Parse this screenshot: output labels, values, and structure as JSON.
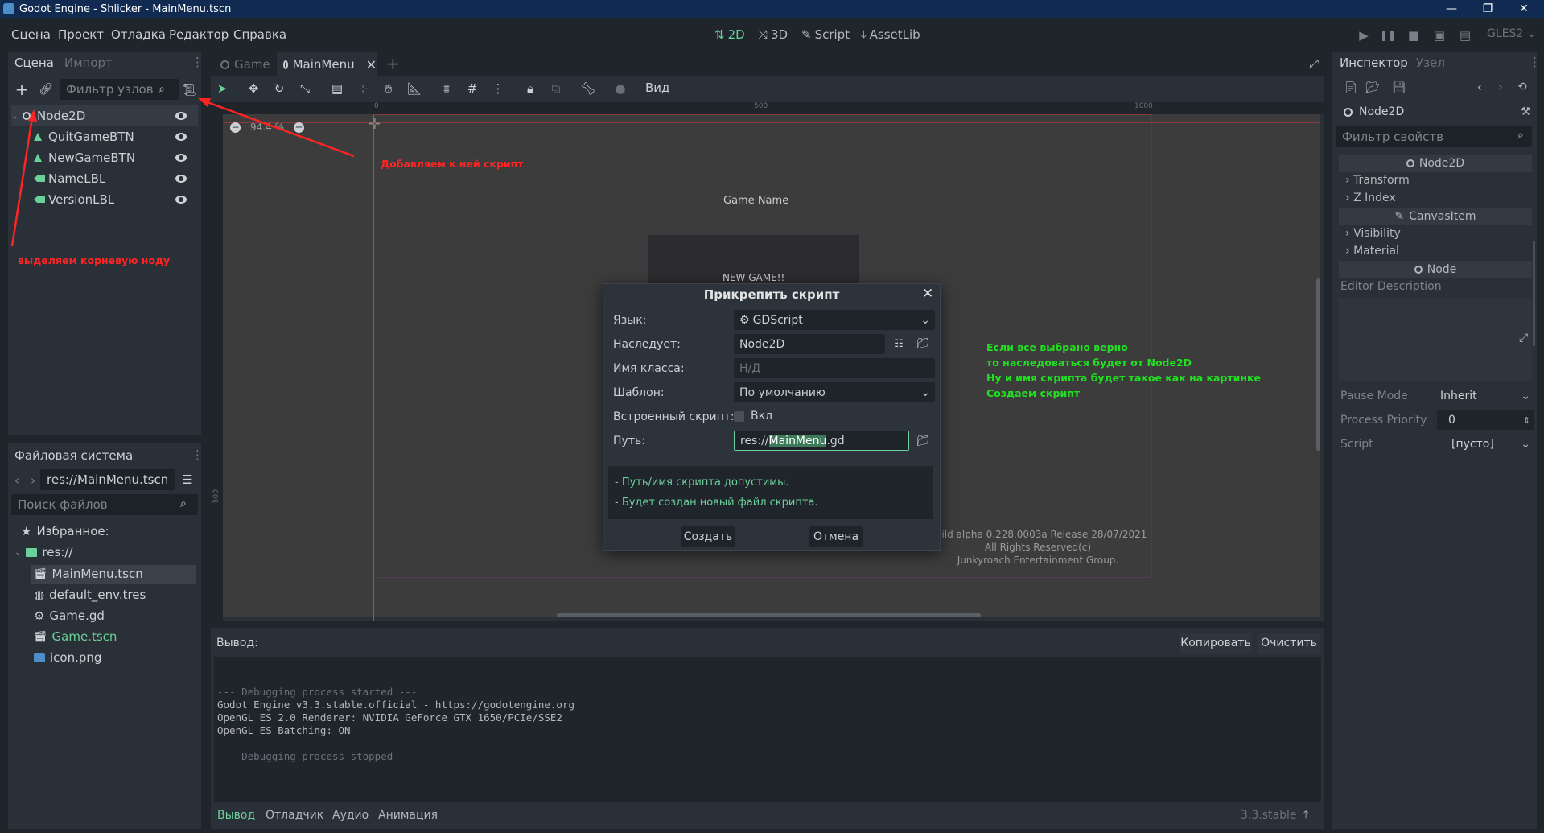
{
  "window": {
    "title": "Godot Engine - Shlicker - MainMenu.tscn",
    "controls": [
      "—",
      "❐",
      "✕"
    ]
  },
  "menubar": {
    "items": [
      "Сцена",
      "Проект",
      "Отладка",
      "Редактор",
      "Справка"
    ],
    "modes": [
      "2D",
      "3D",
      "Script",
      "AssetLib"
    ],
    "renderer": "GLES2"
  },
  "scene_dock": {
    "tabs": [
      "Сцена",
      "Импорт"
    ],
    "filter_placeholder": "Фильтр узлов",
    "nodes": [
      {
        "name": "Node2D",
        "icon": "node2d-icon"
      },
      {
        "name": "QuitGameBTN",
        "icon": "button-icon"
      },
      {
        "name": "NewGameBTN",
        "icon": "button-icon"
      },
      {
        "name": "NameLBL",
        "icon": "label-icon"
      },
      {
        "name": "VersionLBL",
        "icon": "label-icon"
      }
    ]
  },
  "filesystem_dock": {
    "title": "Файловая система",
    "path": "res://MainMenu.tscn",
    "search_placeholder": "Поиск файлов",
    "favorites": "Избранное:",
    "root": "res://",
    "files": [
      {
        "name": "MainMenu.tscn",
        "icon": "scene-icon"
      },
      {
        "name": "default_env.tres",
        "icon": "environment-icon"
      },
      {
        "name": "Game.gd",
        "icon": "gear-icon"
      },
      {
        "name": "Game.tscn",
        "icon": "scene-icon"
      },
      {
        "name": "icon.png",
        "icon": "image-icon"
      }
    ]
  },
  "editor_tabs": [
    "Game",
    "MainMenu"
  ],
  "viewport": {
    "view_menu": "Вид",
    "zoom": "94.4 %",
    "ruler_marks": [
      "0",
      "500",
      "1000"
    ],
    "ruler_v_mark": "500",
    "game_name": "Game Name",
    "new_game": "NEW GAME!!",
    "build_lines": [
      "Build alpha 0.228.0003a Release 28/07/2021",
      "All Rights Reserved(c)",
      "Junkyroach Entertainment Group."
    ]
  },
  "dialog": {
    "title": "Прикрепить скрипт",
    "language_label": "Язык:",
    "language_value": "GDScript",
    "inherits_label": "Наследует:",
    "inherits_value": "Node2D",
    "class_label": "Имя класса:",
    "class_placeholder": "Н/Д",
    "template_label": "Шаблон:",
    "template_value": "По умолчанию",
    "builtin_label": "Встроенный скрипт:",
    "builtin_value": "Вкл",
    "path_label": "Путь:",
    "path_prefix": "res://",
    "path_selected": "MainMenu",
    "path_suffix": ".gd",
    "messages": [
      "- Путь/имя скрипта допустимы.",
      "- Будет создан новый файл скрипта."
    ],
    "create_button": "Создать",
    "cancel_button": "Отмена"
  },
  "annotations": {
    "add_script": "Добавляем к ней скрипт",
    "select_root": "выделяем корневую ноду",
    "green": [
      "Если все выбрано верно",
      "то наследоваться будет от Node2D",
      "Ну и имя скрипта будет такое как на картинке",
      "Создаем скрипт"
    ]
  },
  "output": {
    "title": "Вывод:",
    "copy_button": "Копировать",
    "clear_button": "Очистить",
    "lines": [
      "--- Debugging process started ---",
      "Godot Engine v3.3.stable.official - https://godotengine.org",
      "OpenGL ES 2.0 Renderer: NVIDIA GeForce GTX 1650/PCIe/SSE2",
      "OpenGL ES Batching: ON",
      "",
      "--- Debugging process stopped ---"
    ],
    "bottom_tabs": [
      "Вывод",
      "Отладчик",
      "Аудио",
      "Анимация"
    ],
    "version": "3.3.stable"
  },
  "inspector": {
    "tabs": [
      "Инспектор",
      "Узел"
    ],
    "node": "Node2D",
    "filter_placeholder": "Фильтр свойств",
    "sections": {
      "node2d": "Node2D",
      "canvas": "CanvasItem",
      "node": "Node"
    },
    "categories": {
      "transform": "Transform",
      "zindex": "Z Index",
      "visibility": "Visibility",
      "material": "Material"
    },
    "editor_description": "Editor Description",
    "pause_mode_label": "Pause Mode",
    "pause_mode_value": "Inherit",
    "process_priority_label": "Process Priority",
    "process_priority_value": "0",
    "script_label": "Script",
    "script_value": "[пусто]"
  },
  "colors": {
    "accent": "#6bd09a",
    "titlebar": "#102a52",
    "annotation_red": "#ff2424",
    "annotation_green": "#21e021"
  }
}
